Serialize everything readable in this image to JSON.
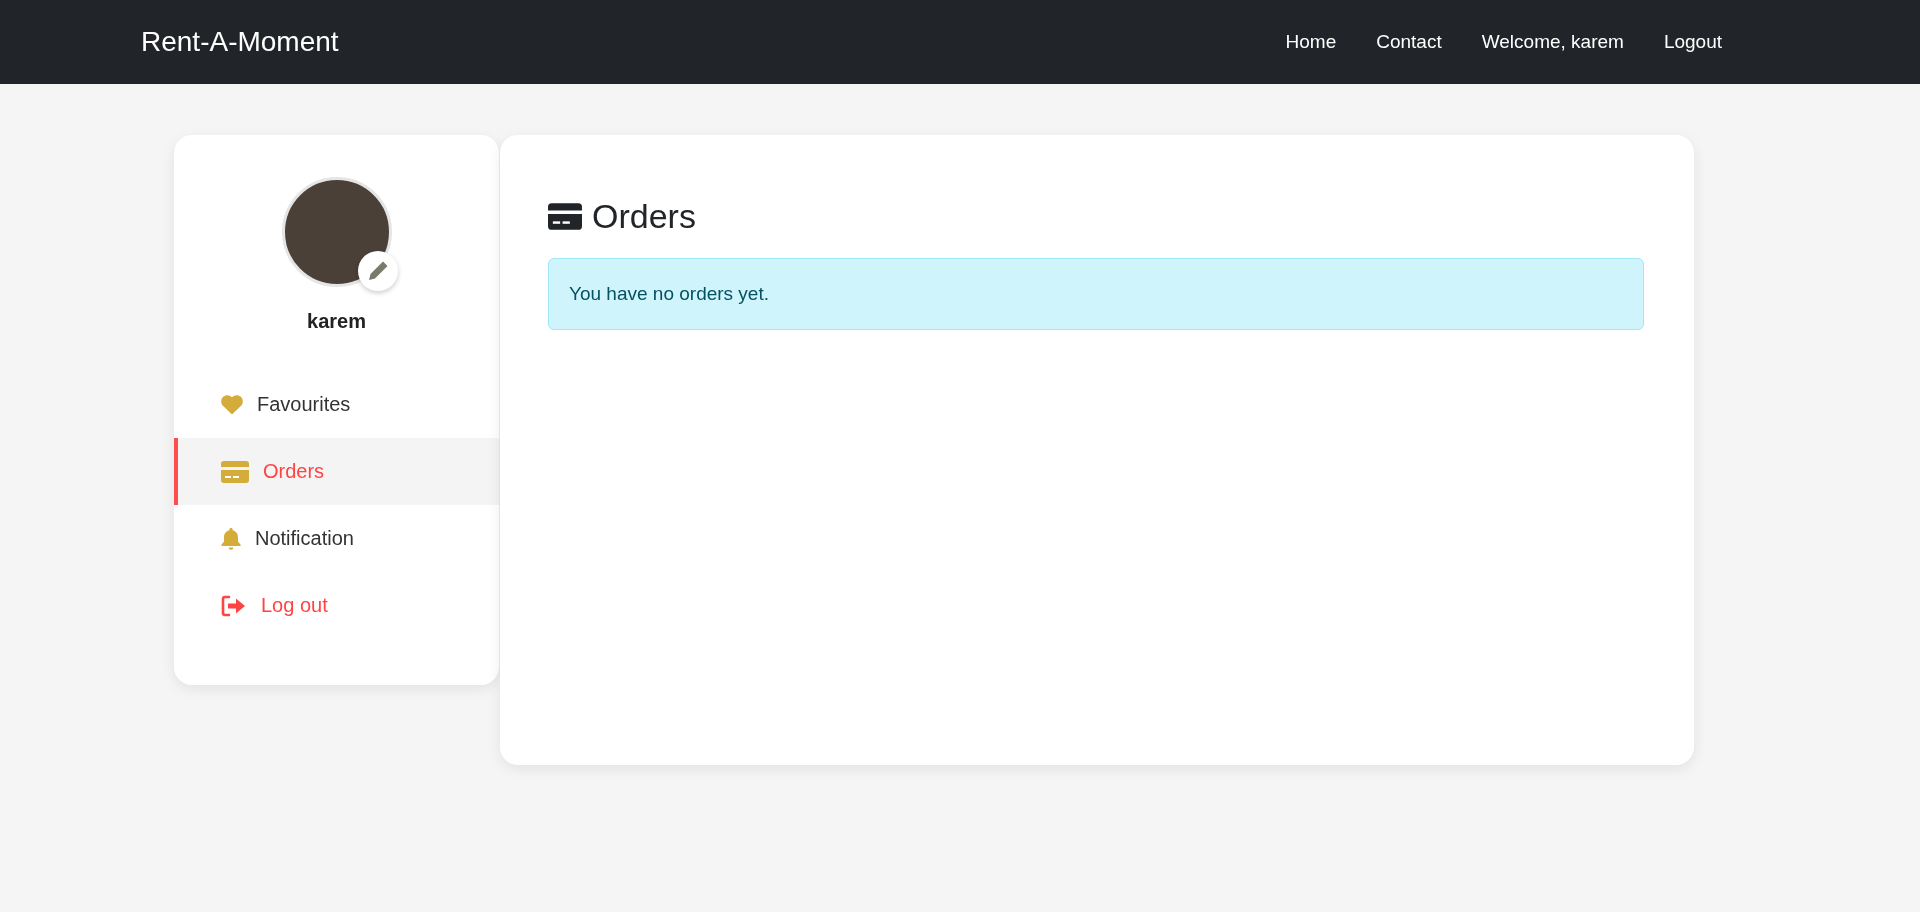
{
  "navbar": {
    "brand": "Rent-A-Moment",
    "links": [
      "Home",
      "Contact",
      "Welcome, karem",
      "Logout"
    ]
  },
  "profile": {
    "name": "karem"
  },
  "sidebar": {
    "items": [
      {
        "label": "Favourites",
        "kind": "favourites",
        "selected": false
      },
      {
        "label": "Orders",
        "kind": "orders",
        "selected": true
      },
      {
        "label": "Notification",
        "kind": "notification",
        "selected": false
      },
      {
        "label": "Log out",
        "kind": "logout",
        "selected": false
      }
    ]
  },
  "main": {
    "title": "Orders",
    "alert": "You have no orders yet."
  }
}
